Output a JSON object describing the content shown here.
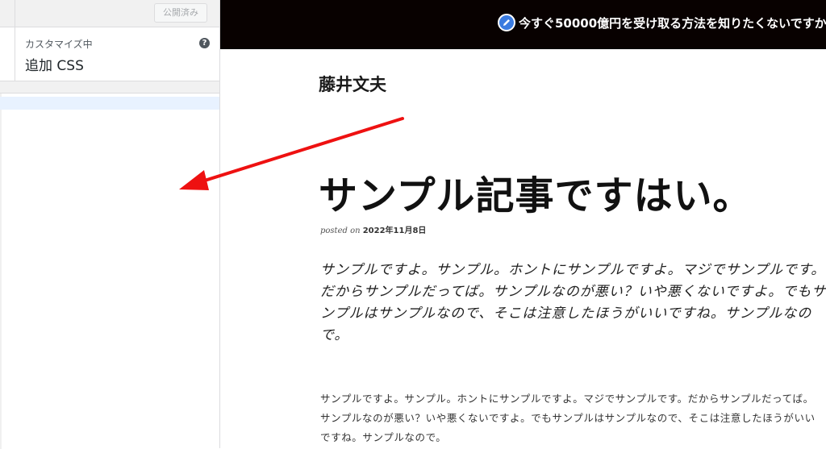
{
  "sidebar": {
    "publish_label": "公開済み",
    "section_subtitle": "カスタマイズ中",
    "section_title": "追加 CSS",
    "help_symbol": "?"
  },
  "preview": {
    "banner_text": "今すぐ50000億円を受け取る方法を知りたくないですか",
    "site_title": "藤井文夫",
    "post_title": "サンプル記事ですはい。",
    "meta_label": "posted on",
    "meta_date": "2022年11月8日",
    "lead_paragraph": "サンプルですよ。サンプル。ホントにサンプルですよ。マジでサンプルです。だからサンプルだってば。サンプルなのが悪い？いや悪くないですよ。でもサンプルはサンプルなので、そこは注意したほうがいいですね。サンプルなので。",
    "body_paragraph": "サンプルですよ。サンプル。ホントにサンプルですよ。マジでサンプルです。だからサンプルだってば。サンプルなのが悪い？いや悪くないですよ。でもサンプルはサンプルなので、そこは注意したほうがいいですね。サンプルなので。"
  },
  "icons": {
    "banner_icon": "pencil-icon",
    "help_icon": "help-icon",
    "annotation": "red-arrow"
  },
  "colors": {
    "banner_bg": "#080100",
    "banner_icon_bg": "#3a7be0",
    "arrow": "#ee1111",
    "active_line": "#e8f2ff"
  }
}
